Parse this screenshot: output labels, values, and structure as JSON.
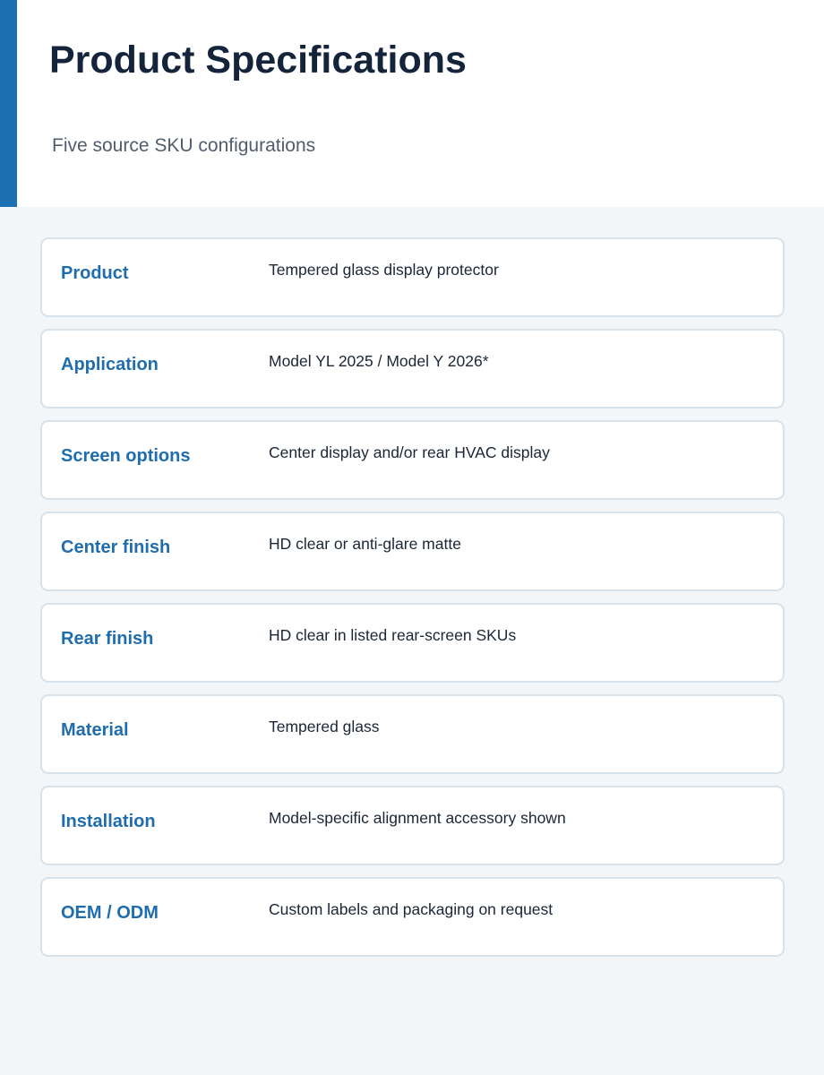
{
  "header": {
    "title": "Product Specifications",
    "subtitle": "Five source SKU configurations",
    "accent_color": "#1c6fb0"
  },
  "specs": [
    {
      "label": "Product",
      "value": "Tempered glass display protector"
    },
    {
      "label": "Application",
      "value": "Model YL 2025 / Model Y 2026*"
    },
    {
      "label": "Screen options",
      "value": "Center display and/or rear HVAC display"
    },
    {
      "label": "Center finish",
      "value": "HD clear or anti-glare matte"
    },
    {
      "label": "Rear finish",
      "value": "HD clear in listed rear-screen SKUs"
    },
    {
      "label": "Material",
      "value": "Tempered glass"
    },
    {
      "label": "Installation",
      "value": "Model-specific alignment accessory shown"
    },
    {
      "label": "OEM / ODM",
      "value": "Custom labels and packaging on request"
    }
  ]
}
